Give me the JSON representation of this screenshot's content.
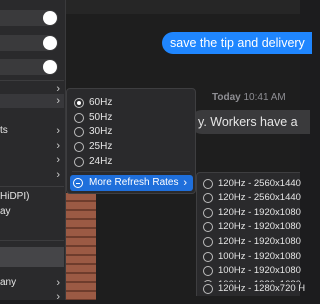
{
  "messages": {
    "sent_text": "save the tip and delivery",
    "timestamp_day": "Today",
    "timestamp_time": "10:41 AM",
    "received_text": "y.  Workers have a"
  },
  "left_menu": {
    "items": [
      {
        "text": "",
        "has_chevron": true
      },
      {
        "text": "",
        "has_chevron": true
      },
      {
        "text": "ts",
        "has_chevron": true
      },
      {
        "text": "",
        "has_chevron": true
      },
      {
        "text": "",
        "has_chevron": true
      },
      {
        "text": "",
        "has_chevron": true
      },
      {
        "text": "HiDPI)",
        "has_chevron": false
      },
      {
        "text": "ay",
        "has_chevron": false
      },
      {
        "text": "",
        "has_chevron": false
      },
      {
        "text": "",
        "has_chevron": false
      },
      {
        "text": "any",
        "has_chevron": true
      },
      {
        "text": "",
        "has_chevron": true
      }
    ]
  },
  "refresh_menu": {
    "options": [
      {
        "label": "60Hz",
        "selected": true
      },
      {
        "label": "50Hz",
        "selected": false
      },
      {
        "label": "30Hz",
        "selected": false
      },
      {
        "label": "25Hz",
        "selected": false
      },
      {
        "label": "24Hz",
        "selected": false
      }
    ],
    "more_label": "More Refresh Rates"
  },
  "resolution_menu": {
    "options": [
      "120Hz - 2560x1440",
      "120Hz - 2560x1440",
      "120Hz - 1920x1080",
      "120Hz - 1920x1080",
      "120Hz - 1920x1080",
      "100Hz - 1920x1080",
      "100Hz - 1920x1080",
      "100Hz - 1920x1080",
      "120Hz - 1280x720 H"
    ]
  },
  "colors": {
    "accent": "#1f6fdb",
    "bubble_blue": "#1f86ff",
    "menu_bg": "#2a2a2c"
  }
}
